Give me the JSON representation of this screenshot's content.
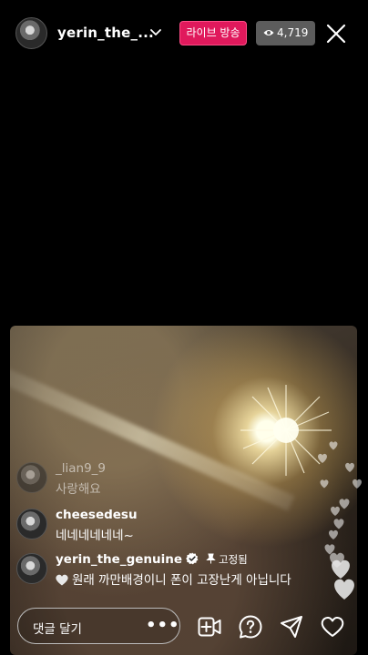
{
  "header": {
    "host_name": "yerin_the_...",
    "live_label": "라이브 방송",
    "viewer_count": "4,719",
    "icons": {
      "chevron": "chevron-down-icon",
      "eye": "eye-icon",
      "close": "close-icon"
    }
  },
  "comments": [
    {
      "username": "_lian9_9",
      "text": "사랑해요",
      "faded": true
    },
    {
      "username": "cheesedesu",
      "text": "네네네네네네~",
      "faded": false
    },
    {
      "username": "yerin_the_genuine",
      "text": "원래 까만배경이니 폰이 고장난게 아닙니다",
      "verified": true,
      "pinned_label": "고정됨",
      "prefix_icon": "heart-icon"
    }
  ],
  "input": {
    "placeholder": "댓글 달기",
    "more": "•••"
  },
  "actions": [
    {
      "name": "add-video-icon"
    },
    {
      "name": "question-icon"
    },
    {
      "name": "send-icon"
    },
    {
      "name": "heart-icon"
    }
  ],
  "colors": {
    "live_badge": "#e0195c",
    "viewer_badge": "#5c5c5c",
    "background": "#000000"
  }
}
